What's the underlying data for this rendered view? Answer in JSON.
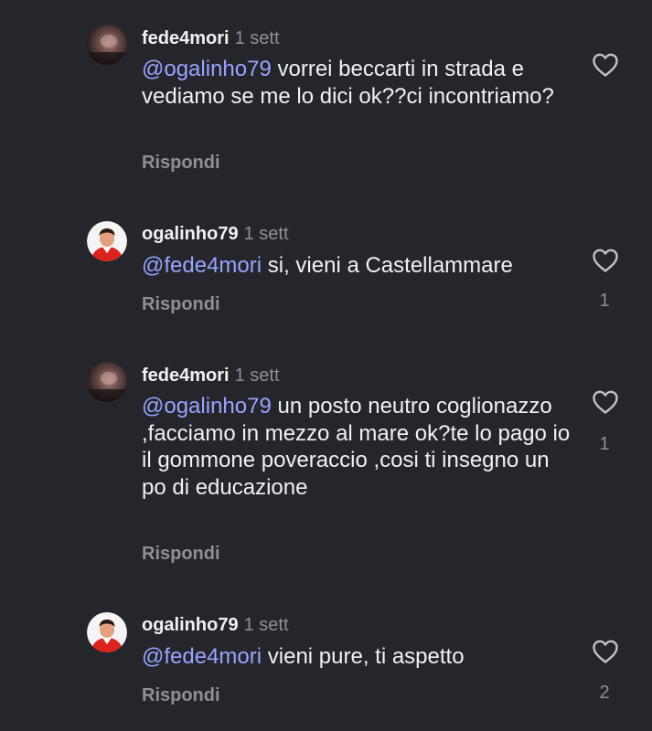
{
  "colors": {
    "background": "#24262b",
    "text": "#f1f1f3",
    "secondary": "#8e9098",
    "mention": "#9aa3ff"
  },
  "comments": [
    {
      "username": "fede4mori",
      "time": "1 sett",
      "mention": "@ogalinho79",
      "text": " vorrei beccarti in strada e vediamo se me lo dici ok??ci incontriamo?",
      "reply_label": "Rispondi",
      "like_icon": "heart-outline-icon",
      "like_count": ""
    },
    {
      "username": "ogalinho79",
      "time": "1 sett",
      "mention": "@fede4mori",
      "text": " si, vieni a Castellammare",
      "reply_label": "Rispondi",
      "like_icon": "heart-outline-icon",
      "like_count": "1"
    },
    {
      "username": "fede4mori",
      "time": "1 sett",
      "mention": "@ogalinho79",
      "text": " un posto neutro coglionazzo ,facciamo in mezzo al mare ok?te lo pago io il gommone poveraccio ,cosi ti insegno un po di educazione",
      "reply_label": "Rispondi",
      "like_icon": "heart-outline-icon",
      "like_count": "1"
    },
    {
      "username": "ogalinho79",
      "time": "1 sett",
      "mention": "@fede4mori",
      "text": " vieni pure, ti aspetto",
      "reply_label": "Rispondi",
      "like_icon": "heart-outline-icon",
      "like_count": "2"
    }
  ]
}
